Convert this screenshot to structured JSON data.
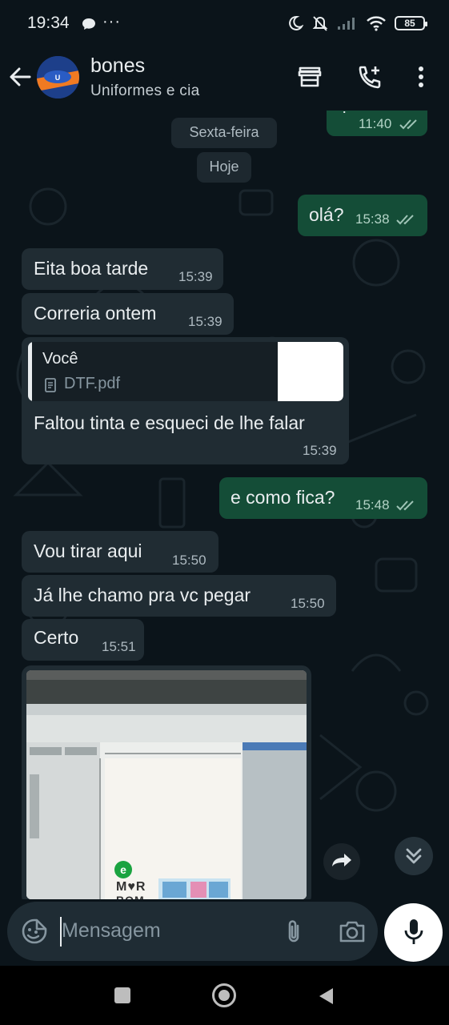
{
  "status_bar": {
    "time": "19:34",
    "more": "···",
    "battery": "85"
  },
  "header": {
    "contact_name": "bones",
    "subtitle": "Uniformes e cia"
  },
  "messages": {
    "top_partial": {
      "text": "?",
      "time": "11:40"
    },
    "date_friday": "Sexta-feira",
    "date_today": "Hoje",
    "m1": {
      "text": "olá?",
      "time": "15:38"
    },
    "m2": {
      "text": "Eita boa tarde",
      "time": "15:39"
    },
    "m3": {
      "text": "Correria ontem",
      "time": "15:39"
    },
    "m4": {
      "quote_author": "Você",
      "quote_file": "DTF.pdf",
      "text": "Faltou tinta e esqueci de lhe falar",
      "time": "15:39"
    },
    "m5": {
      "text": "e como fica?",
      "time": "15:48"
    },
    "m6": {
      "text": "Vou tirar aqui",
      "time": "15:50"
    },
    "m7": {
      "text": "Já lhe chamo pra vc pegar",
      "time": "15:50"
    },
    "m8": {
      "text": "Certo",
      "time": "15:51"
    }
  },
  "image_message": {
    "logo_text_1": "M♥R",
    "logo_text_2": "BOM"
  },
  "composer": {
    "placeholder": "Mensagem"
  },
  "colors": {
    "background": "#0b141a",
    "incoming_bubble": "#202c33",
    "outgoing_bubble": "#144d37",
    "text": "#e9edef",
    "meta": "#aebac1"
  },
  "icons": [
    "back-arrow-icon",
    "shop-icon",
    "add-call-icon",
    "more-vert-icon",
    "emoji-icon",
    "attach-icon",
    "camera-icon",
    "mic-icon",
    "forward-icon",
    "scroll-down-icon"
  ]
}
